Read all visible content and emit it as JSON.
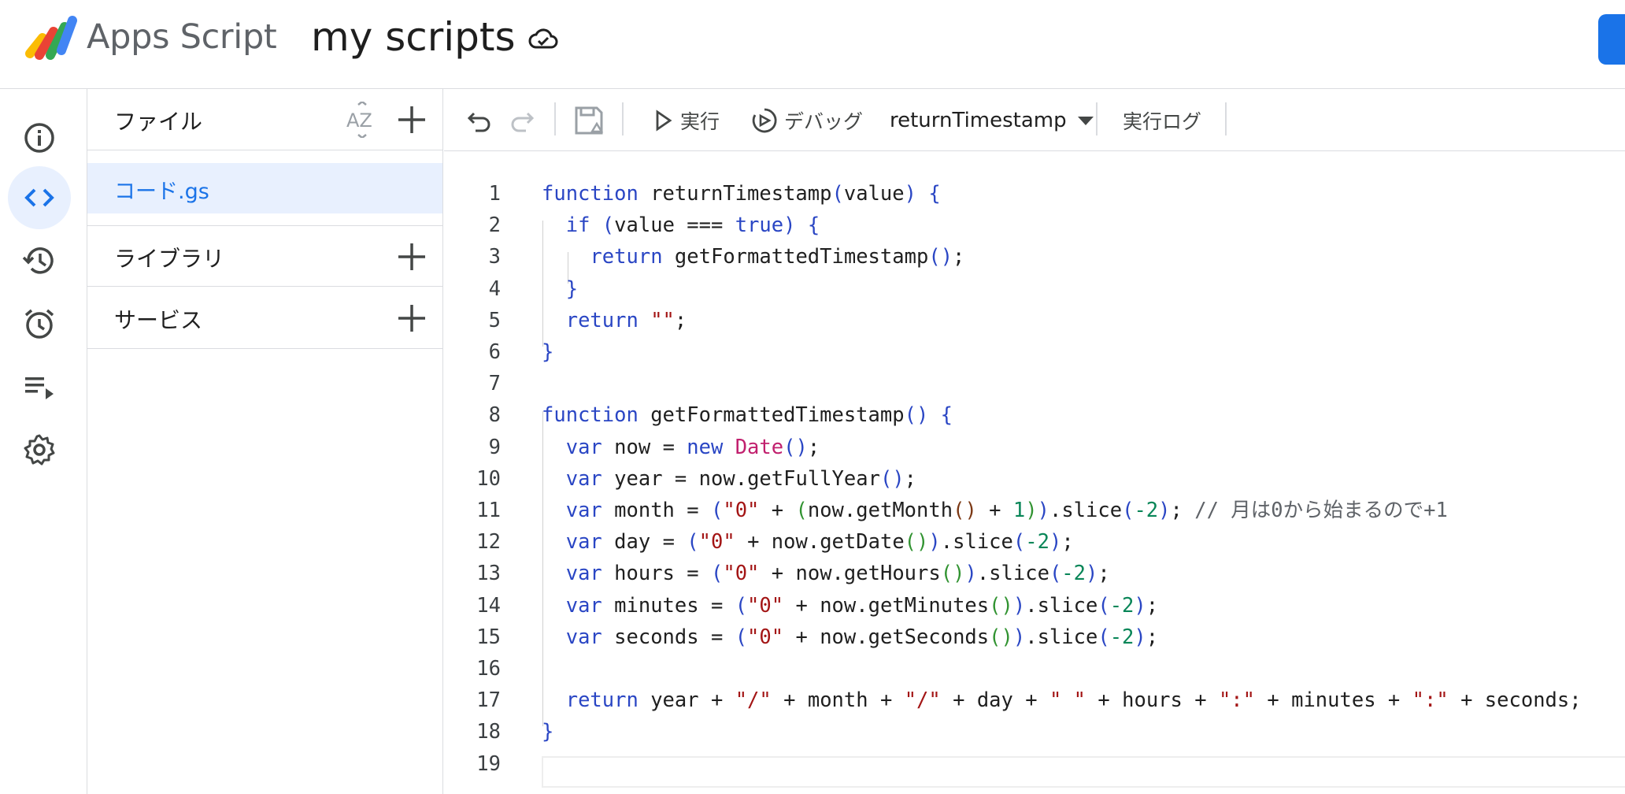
{
  "header": {
    "product_name": "Apps Script",
    "project_title": "my scripts",
    "icons": {
      "cloud": "cloud-done-icon",
      "logo": "apps-script-logo"
    },
    "accent_color": "#1a73e8"
  },
  "rail": {
    "items": [
      {
        "name": "overview",
        "icon": "info-icon"
      },
      {
        "name": "editor",
        "icon": "code-icon",
        "active": true
      },
      {
        "name": "history",
        "icon": "history-icon"
      },
      {
        "name": "triggers",
        "icon": "alarm-icon"
      },
      {
        "name": "executions",
        "icon": "playlist-play-icon"
      },
      {
        "name": "settings",
        "icon": "gear-icon"
      }
    ]
  },
  "files_panel": {
    "files_label": "ファイル",
    "sort_label": "AZ",
    "files": [
      {
        "name": "コード.gs",
        "selected": true
      }
    ],
    "libraries_label": "ライブラリ",
    "services_label": "サービス"
  },
  "toolbar": {
    "run_label": "実行",
    "debug_label": "デバッグ",
    "function_selected": "returnTimestamp",
    "execution_log_label": "実行ログ"
  },
  "editor": {
    "line_numbers": [
      "1",
      "2",
      "3",
      "4",
      "5",
      "6",
      "7",
      "8",
      "9",
      "10",
      "11",
      "12",
      "13",
      "14",
      "15",
      "16",
      "17",
      "18",
      "19"
    ],
    "lines": [
      "function returnTimestamp(value) {",
      "  if (value === true) {",
      "    return getFormattedTimestamp();",
      "  }",
      "  return \"\";",
      "}",
      "",
      "function getFormattedTimestamp() {",
      "  var now = new Date();",
      "  var year = now.getFullYear();",
      "  var month = (\"0\" + (now.getMonth() + 1)).slice(-2); // 月は0から始まるので+1",
      "  var day = (\"0\" + now.getDate()).slice(-2);",
      "  var hours = (\"0\" + now.getHours()).slice(-2);",
      "  var minutes = (\"0\" + now.getMinutes()).slice(-2);",
      "  var seconds = (\"0\" + now.getSeconds()).slice(-2);",
      "",
      "  return year + \"/\" + month + \"/\" + day + \" \" + hours + \":\" + minutes + \":\" + seconds;",
      "}",
      ""
    ]
  }
}
